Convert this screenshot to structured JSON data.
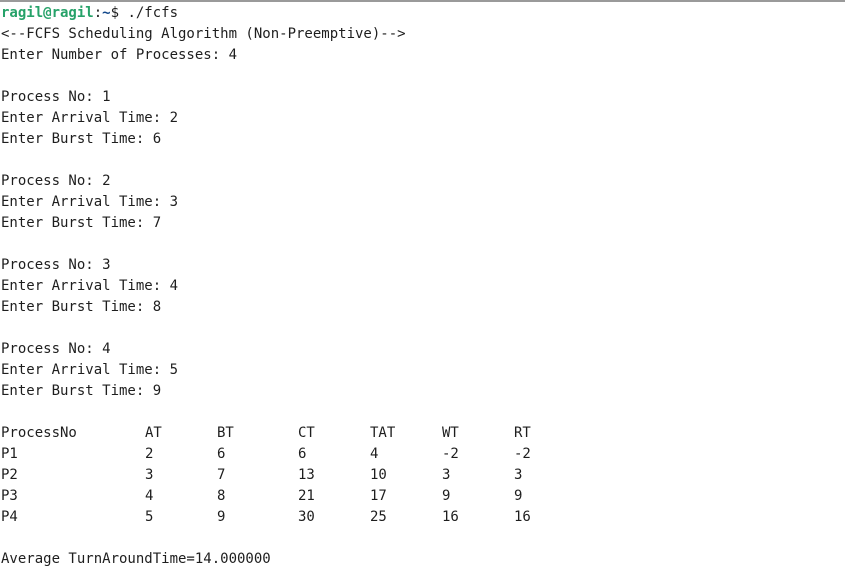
{
  "prompt": {
    "user_host": "ragil@ragil",
    "separator": ":",
    "path": "~",
    "symbol": "$ ",
    "command": "./fcfs"
  },
  "header": "<--FCFS Scheduling Algorithm (Non-Preemptive)-->",
  "num_processes_prompt": "Enter Number of Processes: 4",
  "processes": [
    {
      "no": "Process No: 1",
      "arrival": "Enter Arrival Time: 2",
      "burst": "Enter Burst Time: 6"
    },
    {
      "no": "Process No: 2",
      "arrival": "Enter Arrival Time: 3",
      "burst": "Enter Burst Time: 7"
    },
    {
      "no": "Process No: 3",
      "arrival": "Enter Arrival Time: 4",
      "burst": "Enter Burst Time: 8"
    },
    {
      "no": "Process No: 4",
      "arrival": "Enter Arrival Time: 5",
      "burst": "Enter Burst Time: 9"
    }
  ],
  "table": {
    "headers": [
      "ProcessNo",
      "AT",
      "BT",
      "CT",
      "TAT",
      "WT",
      "RT"
    ],
    "rows": [
      [
        "P1",
        "2",
        "6",
        "6",
        "4",
        "-2",
        "-2"
      ],
      [
        "P2",
        "3",
        "7",
        "13",
        "10",
        "3",
        "3"
      ],
      [
        "P3",
        "4",
        "8",
        "21",
        "17",
        "9",
        "9"
      ],
      [
        "P4",
        "5",
        "9",
        "30",
        "25",
        "16",
        "16"
      ]
    ]
  },
  "average": "Average TurnAroundTime=14.000000"
}
